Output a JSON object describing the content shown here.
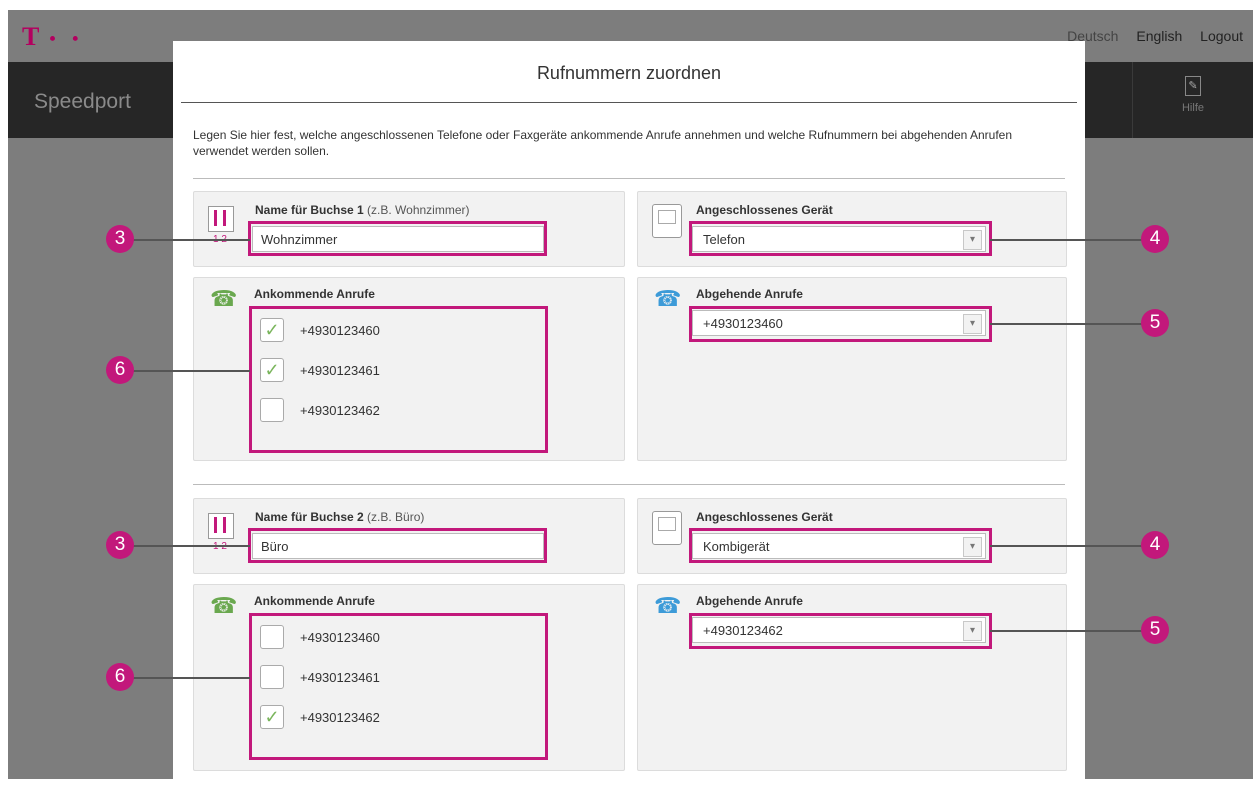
{
  "top_bar": {
    "logo": "T",
    "logo_dots": "• •",
    "languages": [
      "Deutsch",
      "English"
    ],
    "logout": "Logout"
  },
  "nav": {
    "brand": "Speedport",
    "help": "Hilfe"
  },
  "dialog": {
    "title": "Rufnummern zuordnen",
    "intro": "Legen Sie hier fest, welche angeschlossenen Telefone oder Faxgeräte ankommende Anrufe annehmen und welche Rufnummern bei abgehenden Anrufen verwendet werden sollen.",
    "sockets": [
      {
        "name_label": "Name für Buchse 1",
        "name_hint": "(z.B. Wohnzimmer)",
        "socket_sub": "1 2",
        "name_value": "Wohnzimmer",
        "device_label": "Angeschlossenes Gerät",
        "device_value": "Telefon",
        "incoming_label": "Ankommende Anrufe",
        "incoming": [
          {
            "number": "+4930123460",
            "checked": true,
            "mark": "✓"
          },
          {
            "number": "+4930123461",
            "checked": true,
            "mark": "✓"
          },
          {
            "number": "+4930123462",
            "checked": false,
            "mark": ""
          }
        ],
        "outgoing_label": "Abgehende Anrufe",
        "outgoing_value": "+4930123460"
      },
      {
        "name_label": "Name für Buchse 2",
        "name_hint": "(z.B. Büro)",
        "socket_sub": "1 2",
        "name_value": "Büro",
        "device_label": "Angeschlossenes Gerät",
        "device_value": "Kombigerät",
        "incoming_label": "Ankommende Anrufe",
        "incoming": [
          {
            "number": "+4930123460",
            "checked": false,
            "mark": ""
          },
          {
            "number": "+4930123461",
            "checked": false,
            "mark": ""
          },
          {
            "number": "+4930123462",
            "checked": true,
            "mark": "✓"
          }
        ],
        "outgoing_label": "Abgehende Anrufe",
        "outgoing_value": "+4930123462"
      }
    ]
  },
  "callouts": {
    "name": "3",
    "device": "4",
    "outgoing": "5",
    "incoming": "6"
  },
  "icons": {
    "dropdown": "chevron-down-icon",
    "check": "checkmark-icon",
    "incoming_call": "phone-incoming-icon",
    "outgoing_call": "phone-outgoing-icon",
    "socket": "phone-socket-icon",
    "device": "telephone-device-icon",
    "help": "edit-note-icon"
  },
  "colors": {
    "accent_magenta": "#c2187b",
    "overlay_gray": "#7d7d7d",
    "navbar": "#262626",
    "check_green": "#7ab55c",
    "incoming_icon": "#6aa84f",
    "outgoing_icon": "#3d9bd8"
  }
}
